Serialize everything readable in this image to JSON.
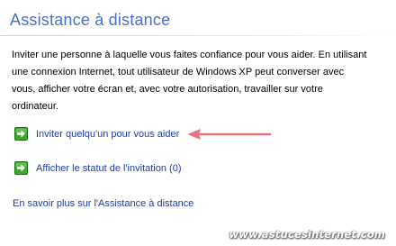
{
  "header": {
    "title": "Assistance à distance"
  },
  "description": {
    "lines": [
      "Inviter une personne à laquelle vous faites confiance pour vous aider. En utilisant",
      "une connexion Internet, tout utilisateur de Windows XP peut converser avec",
      "vous, afficher votre écran et, avec votre autorisation, travailler sur votre",
      "ordinateur."
    ]
  },
  "tasks": [
    {
      "label": "Inviter quelqu'un pour vous aider",
      "icon": "green-arrow-icon"
    },
    {
      "label": "Afficher le statut de l'invitation (0)",
      "icon": "green-arrow-icon"
    }
  ],
  "learn_more": {
    "label": "En savoir plus sur l'Assistance à distance"
  },
  "annotation": {
    "arrow_color": "#e8727a"
  },
  "watermark": {
    "text": "www.astucesinternet.com"
  },
  "colors": {
    "title": "#4a6fc9",
    "link": "#1d3ea3",
    "icon_green": "#3aa829"
  }
}
